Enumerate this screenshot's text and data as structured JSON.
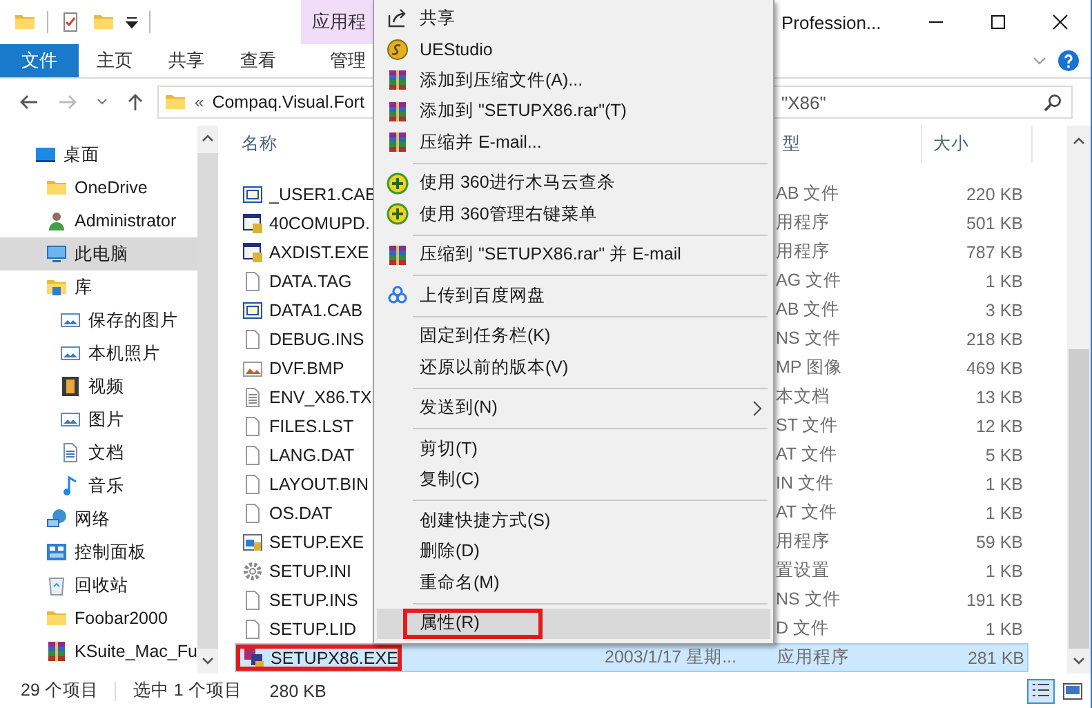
{
  "title_bar": {
    "contextual_tab": "应用程",
    "title": "Profession..."
  },
  "ribbon_tabs": [
    {
      "label": "文件",
      "kind": "file"
    },
    {
      "label": "主页",
      "kind": "tab"
    },
    {
      "label": "共享",
      "kind": "tab"
    },
    {
      "label": "查看",
      "kind": "tab"
    },
    {
      "label": "管理",
      "kind": "contextual"
    }
  ],
  "address": {
    "overflow": "«",
    "path": "Compaq.Visual.Fort",
    "search_placeholder": "\"X86\""
  },
  "navigation": [
    {
      "label": "桌面",
      "kind": "desktop",
      "selected": false,
      "children": [
        {
          "label": "OneDrive",
          "kind": "folder",
          "selected": false
        },
        {
          "label": "Administrator",
          "kind": "user",
          "selected": false
        },
        {
          "label": "此电脑",
          "kind": "computer",
          "selected": true
        },
        {
          "label": "库",
          "kind": "library",
          "selected": false,
          "children": [
            {
              "label": "保存的图片",
              "kind": "pictures",
              "selected": false
            },
            {
              "label": "本机照片",
              "kind": "pictures",
              "selected": false
            },
            {
              "label": "视频",
              "kind": "video",
              "selected": false
            },
            {
              "label": "图片",
              "kind": "pictures",
              "selected": false
            },
            {
              "label": "文档",
              "kind": "document",
              "selected": false
            },
            {
              "label": "音乐",
              "kind": "music",
              "selected": false
            }
          ]
        },
        {
          "label": "网络",
          "kind": "network",
          "selected": false
        },
        {
          "label": "控制面板",
          "kind": "control",
          "selected": false
        },
        {
          "label": "回收站",
          "kind": "recycle",
          "selected": false
        },
        {
          "label": "Foobar2000",
          "kind": "folder",
          "selected": false
        },
        {
          "label": "KSuite_Mac_Fu",
          "kind": "archive",
          "selected": false
        }
      ]
    }
  ],
  "file_list": {
    "columns": [
      {
        "label": "名称"
      },
      {
        "label": "型"
      },
      {
        "label": "大小"
      }
    ],
    "rows": [
      {
        "name": "_USER1.CAB",
        "kind": "cab",
        "type": "AB 文件",
        "size": "220 KB",
        "selected": false,
        "highlighted": false
      },
      {
        "name": "40COMUPD.",
        "kind": "exe",
        "type": "用程序",
        "size": "501 KB",
        "selected": false,
        "highlighted": false
      },
      {
        "name": "AXDIST.EXE",
        "kind": "exe",
        "type": "用程序",
        "size": "787 KB",
        "selected": false,
        "highlighted": false
      },
      {
        "name": "DATA.TAG",
        "kind": "file",
        "type": "AG 文件",
        "size": "1 KB",
        "selected": false,
        "highlighted": false
      },
      {
        "name": "DATA1.CAB",
        "kind": "cab",
        "type": "AB 文件",
        "size": "3 KB",
        "selected": false,
        "highlighted": false
      },
      {
        "name": "DEBUG.INS",
        "kind": "file",
        "type": "NS 文件",
        "size": "218 KB",
        "selected": false,
        "highlighted": false
      },
      {
        "name": "DVF.BMP",
        "kind": "bmp",
        "type": "MP 图像",
        "size": "469 KB",
        "selected": false,
        "highlighted": false
      },
      {
        "name": "ENV_X86.TX",
        "kind": "txt",
        "type": "本文档",
        "size": "13 KB",
        "selected": false,
        "highlighted": false
      },
      {
        "name": "FILES.LST",
        "kind": "file",
        "type": "ST 文件",
        "size": "12 KB",
        "selected": false,
        "highlighted": false
      },
      {
        "name": "LANG.DAT",
        "kind": "file",
        "type": "AT 文件",
        "size": "5 KB",
        "selected": false,
        "highlighted": false
      },
      {
        "name": "LAYOUT.BIN",
        "kind": "file",
        "type": "IN 文件",
        "size": "1 KB",
        "selected": false,
        "highlighted": false
      },
      {
        "name": "OS.DAT",
        "kind": "file",
        "type": "AT 文件",
        "size": "1 KB",
        "selected": false,
        "highlighted": false
      },
      {
        "name": "SETUP.EXE",
        "kind": "setup",
        "type": "用程序",
        "size": "59 KB",
        "selected": false,
        "highlighted": false
      },
      {
        "name": "SETUP.INI",
        "kind": "ini",
        "type": "置设置",
        "size": "1 KB",
        "selected": false,
        "highlighted": false
      },
      {
        "name": "SETUP.INS",
        "kind": "file",
        "type": "NS 文件",
        "size": "191 KB",
        "selected": false,
        "highlighted": false
      },
      {
        "name": "SETUP.LID",
        "kind": "file",
        "type": "D 文件",
        "size": "1 KB",
        "selected": false,
        "highlighted": false
      },
      {
        "name": "SETUPX86.EXE",
        "kind": "installer",
        "date": "2003/1/17 星期...",
        "type": "应用程序",
        "size": "281 KB",
        "selected": true,
        "highlighted": true
      }
    ]
  },
  "context_menu": {
    "sections": [
      {
        "items": [
          {
            "label": "共享",
            "kind": "share",
            "submenu": false,
            "selected": false,
            "highlighted": false
          },
          {
            "label": "UEStudio",
            "kind": "logo",
            "submenu": false,
            "selected": false,
            "highlighted": false
          },
          {
            "label": "添加到压缩文件(A)...",
            "kind": "archive",
            "submenu": false,
            "selected": false,
            "highlighted": false
          },
          {
            "label": "添加到 \"SETUPX86.rar\"(T)",
            "kind": "archive",
            "submenu": false,
            "selected": false,
            "highlighted": false
          },
          {
            "label": "压缩并 E-mail...",
            "kind": "archive",
            "submenu": false,
            "selected": false,
            "highlighted": false
          }
        ]
      },
      {
        "items": [
          {
            "label": "使用 360进行木马云查杀",
            "kind": "shield",
            "submenu": false,
            "selected": false,
            "highlighted": false
          },
          {
            "label": "使用 360管理右键菜单",
            "kind": "shield",
            "submenu": false,
            "selected": false,
            "highlighted": false
          }
        ]
      },
      {
        "items": [
          {
            "label": "压缩到 \"SETUPX86.rar\" 并 E-mail",
            "kind": "archive",
            "submenu": false,
            "selected": false,
            "highlighted": false
          }
        ]
      },
      {
        "items": [
          {
            "label": "上传到百度网盘",
            "kind": "cloud",
            "submenu": false,
            "selected": false,
            "highlighted": false
          }
        ]
      },
      {
        "items": [
          {
            "label": "固定到任务栏(K)",
            "kind": "plain",
            "submenu": false,
            "selected": false,
            "highlighted": false
          },
          {
            "label": "还原以前的版本(V)",
            "kind": "plain",
            "submenu": false,
            "selected": false,
            "highlighted": false
          }
        ]
      },
      {
        "items": [
          {
            "label": "发送到(N)",
            "kind": "plain",
            "submenu": true,
            "selected": false,
            "highlighted": false
          }
        ]
      },
      {
        "items": [
          {
            "label": "剪切(T)",
            "kind": "plain",
            "submenu": false,
            "selected": false,
            "highlighted": false
          },
          {
            "label": "复制(C)",
            "kind": "plain",
            "submenu": false,
            "selected": false,
            "highlighted": false
          }
        ]
      },
      {
        "items": [
          {
            "label": "创建快捷方式(S)",
            "kind": "plain",
            "submenu": false,
            "selected": false,
            "highlighted": false
          },
          {
            "label": "删除(D)",
            "kind": "plain",
            "submenu": false,
            "selected": false,
            "highlighted": false
          },
          {
            "label": "重命名(M)",
            "kind": "plain",
            "submenu": false,
            "selected": false,
            "highlighted": false
          }
        ]
      },
      {
        "items": [
          {
            "label": "属性(R)",
            "kind": "plain",
            "submenu": false,
            "selected": true,
            "highlighted": true
          }
        ]
      }
    ]
  },
  "status_bar": {
    "count": "29 个项目",
    "selection": "选中 1 个项目",
    "size": "280 KB",
    "views": [
      {
        "kind": "details",
        "selected": true
      },
      {
        "kind": "thumbnails",
        "selected": false
      }
    ]
  }
}
